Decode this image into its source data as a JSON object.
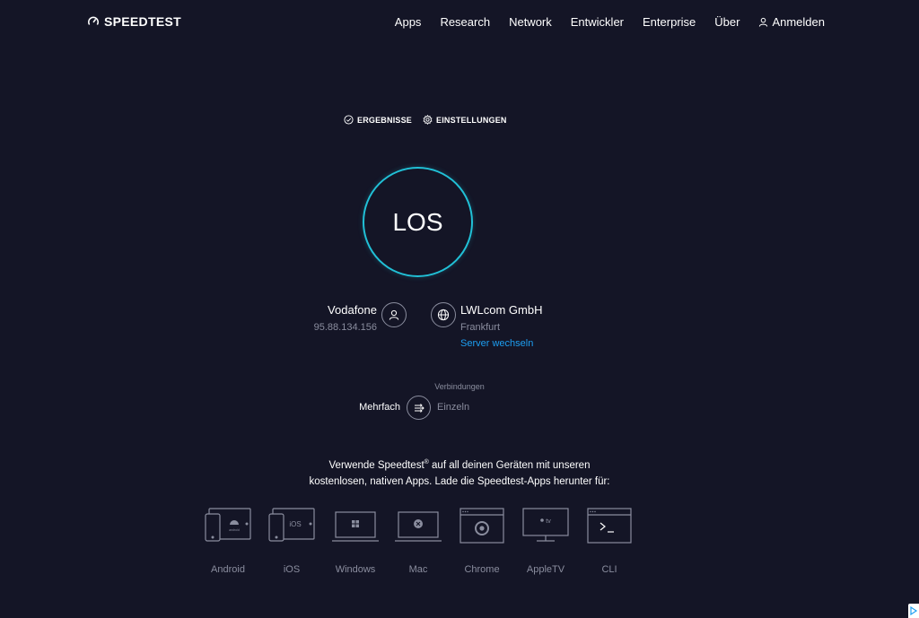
{
  "header": {
    "logo_text": "SPEEDTEST",
    "nav": [
      "Apps",
      "Research",
      "Network",
      "Entwickler",
      "Enterprise",
      "Über"
    ],
    "login": "Anmelden"
  },
  "subnav": {
    "results": "ERGEBNISSE",
    "settings": "EINSTELLUNGEN"
  },
  "go_button": "LOS",
  "isp": {
    "name": "Vodafone",
    "ip": "95.88.134.156"
  },
  "server": {
    "name": "LWLcom GmbH",
    "city": "Frankfurt",
    "change": "Server wechseln"
  },
  "connections": {
    "label": "Verbindungen",
    "multi": "Mehrfach",
    "single": "Einzeln"
  },
  "promo": {
    "line1_before": "Verwende Speedtest",
    "registered": "®",
    "line1_after": " auf all deinen Geräten mit unseren",
    "line2": "kostenlosen, nativen Apps. Lade die Speedtest-Apps herunter für:"
  },
  "apps": [
    {
      "label": "Android",
      "icon": "android-devices-icon"
    },
    {
      "label": "iOS",
      "icon": "ios-devices-icon"
    },
    {
      "label": "Windows",
      "icon": "windows-laptop-icon"
    },
    {
      "label": "Mac",
      "icon": "mac-laptop-icon"
    },
    {
      "label": "Chrome",
      "icon": "chrome-browser-icon"
    },
    {
      "label": "AppleTV",
      "icon": "appletv-icon"
    },
    {
      "label": "CLI",
      "icon": "cli-terminal-icon"
    }
  ],
  "colors": {
    "background": "#141526",
    "accent_ring": "#21c0d6",
    "link": "#1d9ff2",
    "muted_text": "#8a8d9e"
  }
}
